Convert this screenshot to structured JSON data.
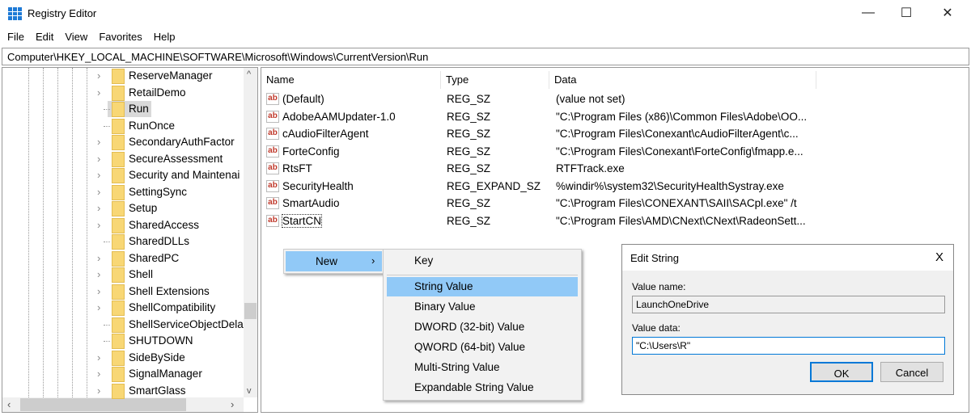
{
  "window": {
    "title": "Registry Editor",
    "minimize": "—",
    "maximize": "☐",
    "close": "✕"
  },
  "menu": [
    "File",
    "Edit",
    "View",
    "Favorites",
    "Help"
  ],
  "address": "Computer\\HKEY_LOCAL_MACHINE\\SOFTWARE\\Microsoft\\Windows\\CurrentVersion\\Run",
  "tree": [
    {
      "label": "ReserveManager",
      "expandable": true
    },
    {
      "label": "RetailDemo",
      "expandable": true
    },
    {
      "label": "Run",
      "expandable": false,
      "selected": true
    },
    {
      "label": "RunOnce",
      "expandable": false
    },
    {
      "label": "SecondaryAuthFactor",
      "expandable": true
    },
    {
      "label": "SecureAssessment",
      "expandable": true
    },
    {
      "label": "Security and Maintenai",
      "expandable": true
    },
    {
      "label": "SettingSync",
      "expandable": true
    },
    {
      "label": "Setup",
      "expandable": true
    },
    {
      "label": "SharedAccess",
      "expandable": true
    },
    {
      "label": "SharedDLLs",
      "expandable": false
    },
    {
      "label": "SharedPC",
      "expandable": true
    },
    {
      "label": "Shell",
      "expandable": true
    },
    {
      "label": "Shell Extensions",
      "expandable": true
    },
    {
      "label": "ShellCompatibility",
      "expandable": true
    },
    {
      "label": "ShellServiceObjectDela",
      "expandable": false
    },
    {
      "label": "SHUTDOWN",
      "expandable": false
    },
    {
      "label": "SideBySide",
      "expandable": true
    },
    {
      "label": "SignalManager",
      "expandable": true
    },
    {
      "label": "SmartGlass",
      "expandable": true
    }
  ],
  "columns": [
    "Name",
    "Type",
    "Data"
  ],
  "values": [
    {
      "name": "(Default)",
      "type": "REG_SZ",
      "data": "(value not set)"
    },
    {
      "name": "AdobeAAMUpdater-1.0",
      "type": "REG_SZ",
      "data": "\"C:\\Program Files (x86)\\Common Files\\Adobe\\OO..."
    },
    {
      "name": "cAudioFilterAgent",
      "type": "REG_SZ",
      "data": "\"C:\\Program Files\\Conexant\\cAudioFilterAgent\\c..."
    },
    {
      "name": "ForteConfig",
      "type": "REG_SZ",
      "data": "\"C:\\Program Files\\Conexant\\ForteConfig\\fmapp.e..."
    },
    {
      "name": "RtsFT",
      "type": "REG_SZ",
      "data": "RTFTrack.exe"
    },
    {
      "name": "SecurityHealth",
      "type": "REG_EXPAND_SZ",
      "data": "%windir%\\system32\\SecurityHealthSystray.exe"
    },
    {
      "name": "SmartAudio",
      "type": "REG_SZ",
      "data": "\"C:\\Program Files\\CONEXANT\\SAII\\SACpl.exe\" /t"
    },
    {
      "name": "StartCN",
      "type": "REG_SZ",
      "data": "\"C:\\Program Files\\AMD\\CNext\\CNext\\RadeonSett..."
    }
  ],
  "context_menu": {
    "new_label": "New",
    "submenu": [
      "Key",
      "String Value",
      "Binary Value",
      "DWORD (32-bit) Value",
      "QWORD (64-bit) Value",
      "Multi-String Value",
      "Expandable String Value"
    ],
    "highlighted": "String Value"
  },
  "dialog": {
    "title": "Edit String",
    "value_name_label": "Value name:",
    "value_name": "LaunchOneDrive",
    "value_data_label": "Value data:",
    "value_data": "\"C:\\Users\\R\"",
    "ok": "OK",
    "cancel": "Cancel",
    "close": "X"
  },
  "colors": {
    "highlight": "#91c9f7",
    "folder": "#f8d775",
    "accent": "#0078d7"
  }
}
